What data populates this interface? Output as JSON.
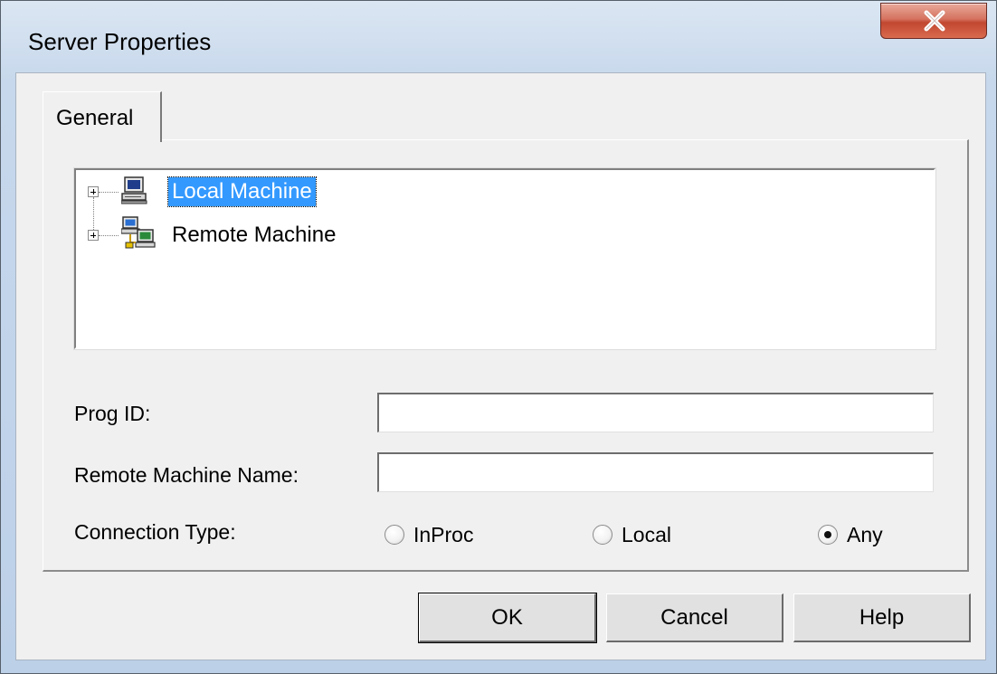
{
  "window": {
    "title": "Server Properties",
    "close_label": "X"
  },
  "tabs": [
    {
      "label": "General"
    }
  ],
  "tree": {
    "items": [
      {
        "label": "Local Machine",
        "icon": "computer-icon",
        "selected": true
      },
      {
        "label": "Remote Machine",
        "icon": "network-computers-icon",
        "selected": false
      }
    ]
  },
  "form": {
    "prog_id": {
      "label": "Prog ID:",
      "value": ""
    },
    "remote_machine_name": {
      "label": "Remote Machine Name:",
      "value": ""
    },
    "connection_type": {
      "label": "Connection Type:",
      "options": [
        "InProc",
        "Local",
        "Any"
      ],
      "selected": "Any"
    }
  },
  "buttons": {
    "ok": "OK",
    "cancel": "Cancel",
    "help": "Help"
  },
  "colors": {
    "selection": "#3399ff",
    "close_button": "#c14730",
    "frame": "#c7d8ec"
  }
}
